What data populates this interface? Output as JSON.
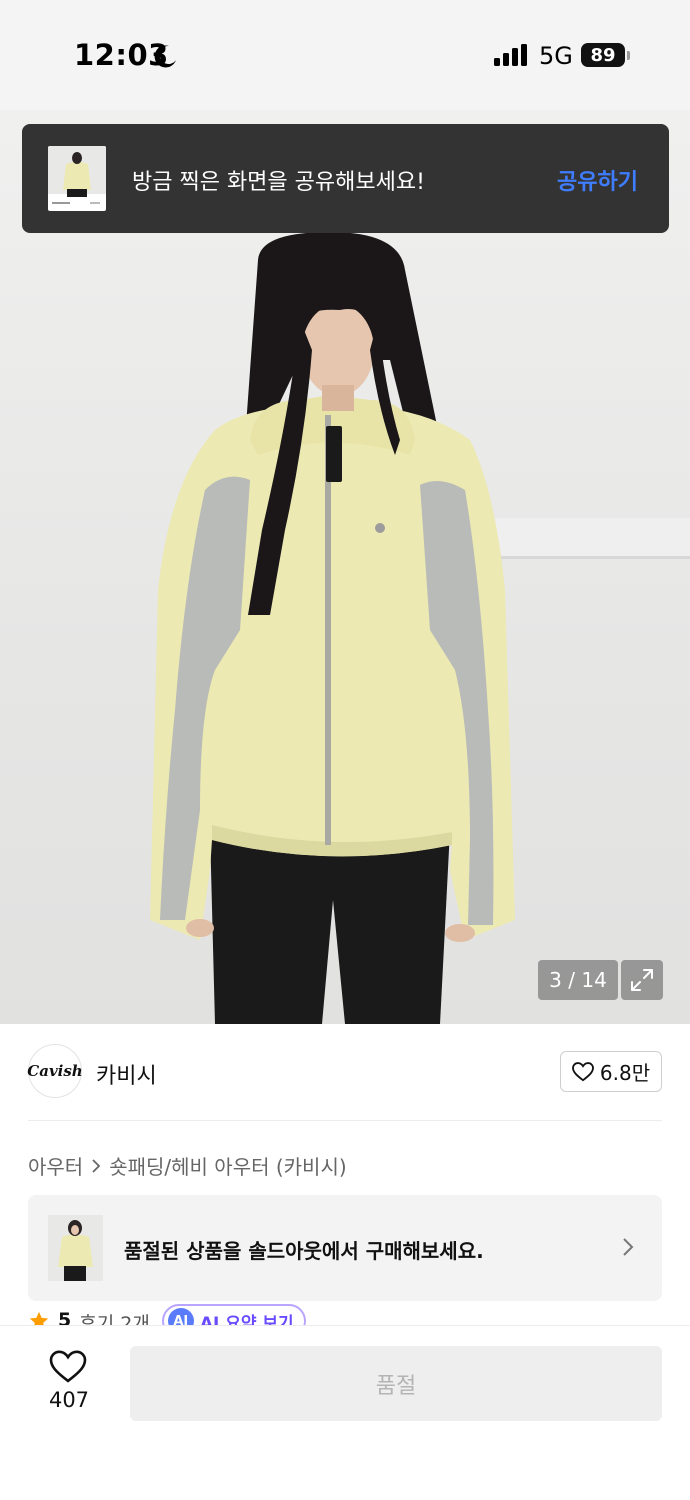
{
  "status_bar": {
    "time": "12:03",
    "moon_icon": "moon-icon",
    "signal_icon": "cellular-signal-icon",
    "network": "5G",
    "battery": "89"
  },
  "toast": {
    "message": "방금 찍은 화면을 공유해보세요!",
    "action_label": "공유하기",
    "action_color": "#3f7dff"
  },
  "gallery": {
    "counter": "3 / 14",
    "expand_icon": "expand-icon"
  },
  "brand": {
    "logo_text": "Cavish",
    "name": "카비시",
    "like_count": "6.8만"
  },
  "breadcrumb": {
    "category": "아우터",
    "subcategory": "숏패딩/헤비 아우터 (카비시)"
  },
  "soldout_banner": {
    "message": "품절된 상품을 솔드아웃에서 구매해보세요."
  },
  "review": {
    "score": "5",
    "count_label": "후기 2개",
    "ai_badge": "AI",
    "ai_label": "AI 요약 보기"
  },
  "bottom_bar": {
    "wish_count": "407",
    "buy_label": "품절"
  }
}
